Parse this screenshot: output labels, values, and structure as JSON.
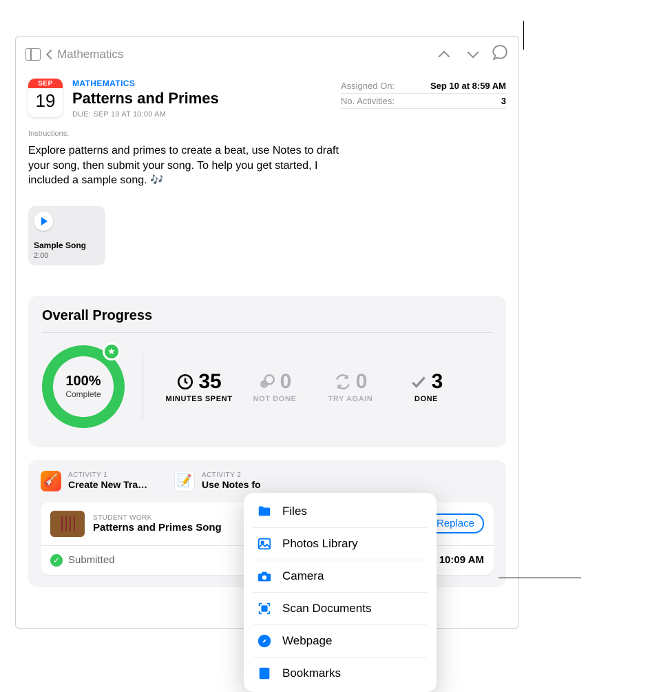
{
  "nav": {
    "back_label": "Mathematics"
  },
  "header": {
    "cal_month": "SEP",
    "cal_day": "19",
    "subject": "MATHEMATICS",
    "title": "Patterns and Primes",
    "due": "DUE: SEP 19 AT 10:00 AM",
    "meta": {
      "assigned_label": "Assigned On:",
      "assigned_value": "Sep 10 at 8:59 AM",
      "activities_label": "No. Activities:",
      "activities_value": "3"
    }
  },
  "instructions": {
    "label": "Instructions:",
    "body": "Explore patterns and primes to create a beat, use Notes to draft your song, then submit your song. To help you get started, I included a sample song. 🎶"
  },
  "sample": {
    "title": "Sample Song",
    "duration": "2:00"
  },
  "progress": {
    "title": "Overall Progress",
    "percent": "100%",
    "percent_label": "Complete",
    "stats": {
      "minutes": "35",
      "minutes_label": "MINUTES SPENT",
      "not_done": "0",
      "not_done_label": "NOT DONE",
      "try_again": "0",
      "try_again_label": "TRY AGAIN",
      "done": "3",
      "done_label": "DONE"
    }
  },
  "activities": {
    "a1_top": "ACTIVITY 1",
    "a1_title": "Create New Tra…",
    "a2_top": "ACTIVITY 2",
    "a2_title": "Use Notes fo"
  },
  "student_work": {
    "label": "STUDENT WORK",
    "title": "Patterns and Primes Song",
    "replace": "Replace",
    "submitted": "Submitted",
    "submitted_time": "10:09 AM"
  },
  "popover": {
    "items": [
      "Files",
      "Photos Library",
      "Camera",
      "Scan Documents",
      "Webpage",
      "Bookmarks"
    ]
  }
}
